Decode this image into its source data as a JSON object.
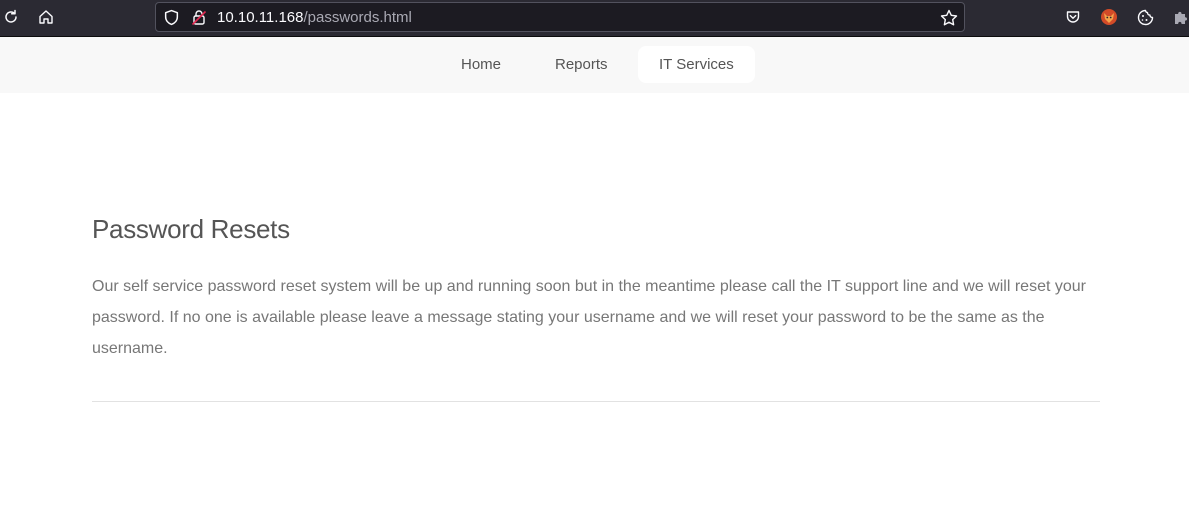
{
  "browser": {
    "url_host": "10.10.11.168",
    "url_path": "/passwords.html",
    "icons": {
      "reload": "reload-icon",
      "home": "home-icon",
      "shield": "tracking-protection-shield-icon",
      "lock": "insecure-lock-icon",
      "bookmark": "star-icon",
      "pocket": "pocket-icon",
      "extension_fox": "foxyproxy-icon",
      "extension_cookie": "cookie-icon",
      "extensions": "puzzle-icon"
    },
    "colors": {
      "toolbar": "#2b2a33",
      "urlbar": "#1c1b22",
      "insecure": "#e22850"
    }
  },
  "nav": {
    "items": [
      {
        "label": "Home",
        "active": false
      },
      {
        "label": "Reports",
        "active": false
      },
      {
        "label": "IT Services",
        "active": true
      }
    ]
  },
  "main": {
    "title": "Password Resets",
    "body": "Our self service password reset system will be up and running soon but in the meantime please call the IT support line and we will reset your password. If no one is available please leave a message stating your username and we will reset your password to be the same as the username."
  }
}
